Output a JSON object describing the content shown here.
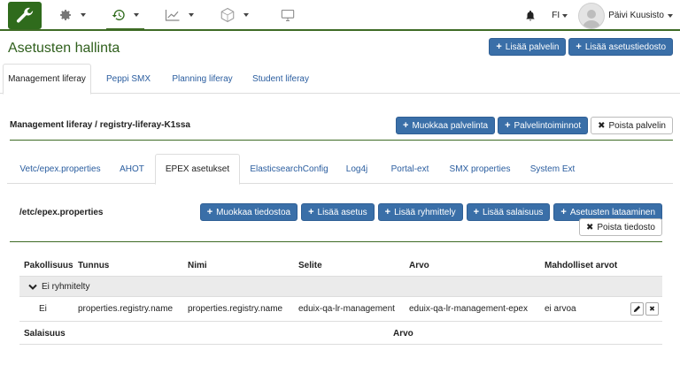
{
  "topnav": {
    "items": [
      {
        "icon": "wrench-icon"
      },
      {
        "icon": "gear-icon"
      },
      {
        "icon": "history-icon"
      },
      {
        "icon": "chart-icon"
      },
      {
        "icon": "network-icon"
      },
      {
        "icon": "monitor-icon"
      }
    ],
    "bell_icon": "bell-icon",
    "language": "FI",
    "user": "Päivi Kuusisto"
  },
  "header": {
    "title": "Asetusten hallinta",
    "add_server": "Lisää palvelin",
    "add_settings_file": "Lisää asetustiedosto"
  },
  "tabs": [
    {
      "label": "Management liferay",
      "active": true
    },
    {
      "label": "Peppi SMX",
      "active": false
    },
    {
      "label": "Planning liferay",
      "active": false
    },
    {
      "label": "Student liferay",
      "active": false
    }
  ],
  "server": {
    "title": "Management liferay / registry-liferay-K1ssa",
    "edit": "Muokkaa palvelinta",
    "actions": "Palvelintoiminnot",
    "delete": "Poista palvelin"
  },
  "subtabs": [
    {
      "label": "Vetc/epex.properties",
      "active": false
    },
    {
      "label": "AHOT",
      "active": false
    },
    {
      "label": "EPEX asetukset",
      "active": true
    },
    {
      "label": "ElasticsearchConfig",
      "active": false
    },
    {
      "label": "Log4j",
      "active": false
    },
    {
      "label": "Portal-ext",
      "active": false
    },
    {
      "label": "SMX properties",
      "active": false
    },
    {
      "label": "System Ext",
      "active": false
    }
  ],
  "file": {
    "title": "/etc/epex.properties",
    "edit": "Muokkaa tiedostoa",
    "add_setting": "Lisää asetus",
    "add_group": "Lisää ryhmittely",
    "add_secret": "Lisää salaisuus",
    "load_settings": "Asetusten lataaminen",
    "delete_file": "Poista tiedosto"
  },
  "table": {
    "headers": {
      "required": "Pakollisuus",
      "key": "Tunnus",
      "name": "Nimi",
      "description": "Selite",
      "value": "Arvo",
      "possible_values": "Mahdolliset arvot"
    },
    "group_label": "Ei ryhmitelty",
    "rows": [
      {
        "required": "Ei",
        "key": "properties.registry.name",
        "name": "properties.registry.name",
        "description": "eduix-qa-lr-management",
        "value": "eduix-qa-lr-management-epex",
        "possible_values": "ei arvoa"
      }
    ],
    "secrets_headers": {
      "secret": "Salaisuus",
      "value": "Arvo"
    }
  }
}
